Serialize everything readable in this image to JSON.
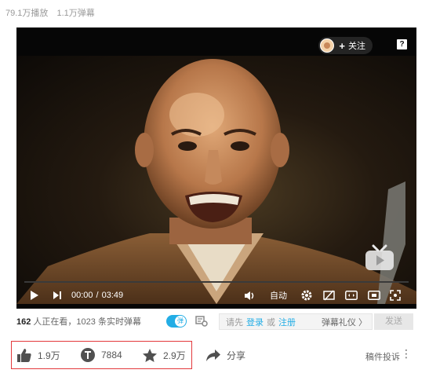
{
  "stats": {
    "plays": "79.1万播放",
    "danmaku": "1.1万弹幕"
  },
  "player": {
    "follow_label": "关注",
    "help_glyph": "?",
    "time_current": "00:00",
    "time_separator": "/",
    "time_total": "03:49",
    "progress": 0,
    "quality_label": "自动"
  },
  "danmaku_bar": {
    "viewers_count": "162",
    "viewers_suffix": " 人正在看，",
    "realtime_count": "1023",
    "realtime_suffix": " 条实时弹幕",
    "toggle_glyph": "弹",
    "prompt_before": "请先",
    "login": "登录",
    "or": "或",
    "register": "注册",
    "etiquette": "弹幕礼仪 〉",
    "send": "发送"
  },
  "actions": {
    "like_count": "1.9万",
    "coin_count": "7884",
    "favorite_count": "2.9万",
    "share_label": "分享",
    "report_label": "稿件投诉",
    "more_glyph": "⋮"
  },
  "colors": {
    "accent": "#23ade5",
    "highlight_border": "#e3393c"
  }
}
